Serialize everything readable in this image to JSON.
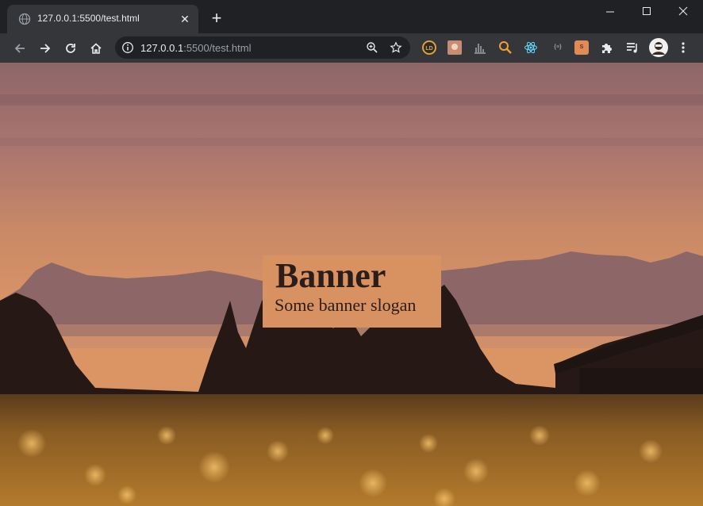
{
  "browser": {
    "tab": {
      "title": "127.0.0.1:5500/test.html",
      "close_glyph": "✕"
    },
    "new_tab_glyph": "+",
    "window_controls": {
      "minimize": "minimize-icon",
      "maximize": "maximize-icon",
      "close": "close-icon"
    },
    "omnibox": {
      "host": "127.0.0.1",
      "path": ":5500/test.html"
    },
    "extensions": [
      {
        "name": "lighthouse",
        "label": "LD",
        "color": "#e0a03c"
      },
      {
        "name": "profile-app",
        "label": "",
        "color": "#c68d72"
      },
      {
        "name": "chart",
        "label": "",
        "color": "#9aa0a6"
      },
      {
        "name": "magnifier",
        "label": "",
        "color": "#f0a030"
      },
      {
        "name": "react-devtools",
        "label": "",
        "color": "#61dafb"
      },
      {
        "name": "json-viewer",
        "label": "{≡}",
        "color": "#9aa0a6"
      },
      {
        "name": "orange-square",
        "label": "S",
        "color": "#e08a55"
      },
      {
        "name": "extensions-puzzle",
        "label": "",
        "color": "#e8eaed"
      },
      {
        "name": "media-control",
        "label": "",
        "color": "#e8eaed"
      },
      {
        "name": "profile-avatar",
        "label": "",
        "color": "#f0f0f0"
      }
    ]
  },
  "page": {
    "banner": {
      "title": "Banner",
      "slogan": "Some banner slogan",
      "background": "#d89160"
    },
    "image_colors": {
      "sky_top": "#8e6667",
      "sky_mid": "#c98967",
      "horizon": "#dc9665",
      "mountains": "#8d6768",
      "trees": "#251815",
      "grass": "#b37a2c"
    }
  }
}
